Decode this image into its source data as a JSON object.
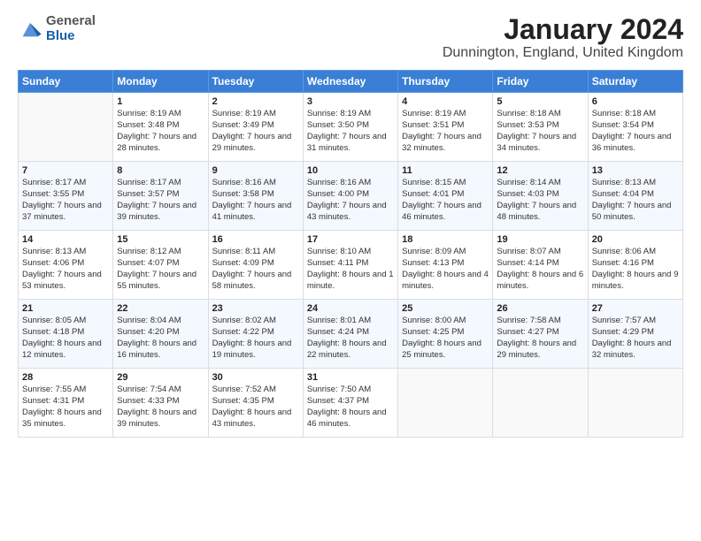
{
  "header": {
    "logo_general": "General",
    "logo_blue": "Blue",
    "title": "January 2024",
    "location": "Dunnington, England, United Kingdom"
  },
  "days_of_week": [
    "Sunday",
    "Monday",
    "Tuesday",
    "Wednesday",
    "Thursday",
    "Friday",
    "Saturday"
  ],
  "weeks": [
    [
      {
        "day": "",
        "empty": true
      },
      {
        "day": "1",
        "sunrise": "Sunrise: 8:19 AM",
        "sunset": "Sunset: 3:48 PM",
        "daylight": "Daylight: 7 hours and 28 minutes."
      },
      {
        "day": "2",
        "sunrise": "Sunrise: 8:19 AM",
        "sunset": "Sunset: 3:49 PM",
        "daylight": "Daylight: 7 hours and 29 minutes."
      },
      {
        "day": "3",
        "sunrise": "Sunrise: 8:19 AM",
        "sunset": "Sunset: 3:50 PM",
        "daylight": "Daylight: 7 hours and 31 minutes."
      },
      {
        "day": "4",
        "sunrise": "Sunrise: 8:19 AM",
        "sunset": "Sunset: 3:51 PM",
        "daylight": "Daylight: 7 hours and 32 minutes."
      },
      {
        "day": "5",
        "sunrise": "Sunrise: 8:18 AM",
        "sunset": "Sunset: 3:53 PM",
        "daylight": "Daylight: 7 hours and 34 minutes."
      },
      {
        "day": "6",
        "sunrise": "Sunrise: 8:18 AM",
        "sunset": "Sunset: 3:54 PM",
        "daylight": "Daylight: 7 hours and 36 minutes."
      }
    ],
    [
      {
        "day": "7",
        "sunrise": "Sunrise: 8:17 AM",
        "sunset": "Sunset: 3:55 PM",
        "daylight": "Daylight: 7 hours and 37 minutes."
      },
      {
        "day": "8",
        "sunrise": "Sunrise: 8:17 AM",
        "sunset": "Sunset: 3:57 PM",
        "daylight": "Daylight: 7 hours and 39 minutes."
      },
      {
        "day": "9",
        "sunrise": "Sunrise: 8:16 AM",
        "sunset": "Sunset: 3:58 PM",
        "daylight": "Daylight: 7 hours and 41 minutes."
      },
      {
        "day": "10",
        "sunrise": "Sunrise: 8:16 AM",
        "sunset": "Sunset: 4:00 PM",
        "daylight": "Daylight: 7 hours and 43 minutes."
      },
      {
        "day": "11",
        "sunrise": "Sunrise: 8:15 AM",
        "sunset": "Sunset: 4:01 PM",
        "daylight": "Daylight: 7 hours and 46 minutes."
      },
      {
        "day": "12",
        "sunrise": "Sunrise: 8:14 AM",
        "sunset": "Sunset: 4:03 PM",
        "daylight": "Daylight: 7 hours and 48 minutes."
      },
      {
        "day": "13",
        "sunrise": "Sunrise: 8:13 AM",
        "sunset": "Sunset: 4:04 PM",
        "daylight": "Daylight: 7 hours and 50 minutes."
      }
    ],
    [
      {
        "day": "14",
        "sunrise": "Sunrise: 8:13 AM",
        "sunset": "Sunset: 4:06 PM",
        "daylight": "Daylight: 7 hours and 53 minutes."
      },
      {
        "day": "15",
        "sunrise": "Sunrise: 8:12 AM",
        "sunset": "Sunset: 4:07 PM",
        "daylight": "Daylight: 7 hours and 55 minutes."
      },
      {
        "day": "16",
        "sunrise": "Sunrise: 8:11 AM",
        "sunset": "Sunset: 4:09 PM",
        "daylight": "Daylight: 7 hours and 58 minutes."
      },
      {
        "day": "17",
        "sunrise": "Sunrise: 8:10 AM",
        "sunset": "Sunset: 4:11 PM",
        "daylight": "Daylight: 8 hours and 1 minute."
      },
      {
        "day": "18",
        "sunrise": "Sunrise: 8:09 AM",
        "sunset": "Sunset: 4:13 PM",
        "daylight": "Daylight: 8 hours and 4 minutes."
      },
      {
        "day": "19",
        "sunrise": "Sunrise: 8:07 AM",
        "sunset": "Sunset: 4:14 PM",
        "daylight": "Daylight: 8 hours and 6 minutes."
      },
      {
        "day": "20",
        "sunrise": "Sunrise: 8:06 AM",
        "sunset": "Sunset: 4:16 PM",
        "daylight": "Daylight: 8 hours and 9 minutes."
      }
    ],
    [
      {
        "day": "21",
        "sunrise": "Sunrise: 8:05 AM",
        "sunset": "Sunset: 4:18 PM",
        "daylight": "Daylight: 8 hours and 12 minutes."
      },
      {
        "day": "22",
        "sunrise": "Sunrise: 8:04 AM",
        "sunset": "Sunset: 4:20 PM",
        "daylight": "Daylight: 8 hours and 16 minutes."
      },
      {
        "day": "23",
        "sunrise": "Sunrise: 8:02 AM",
        "sunset": "Sunset: 4:22 PM",
        "daylight": "Daylight: 8 hours and 19 minutes."
      },
      {
        "day": "24",
        "sunrise": "Sunrise: 8:01 AM",
        "sunset": "Sunset: 4:24 PM",
        "daylight": "Daylight: 8 hours and 22 minutes."
      },
      {
        "day": "25",
        "sunrise": "Sunrise: 8:00 AM",
        "sunset": "Sunset: 4:25 PM",
        "daylight": "Daylight: 8 hours and 25 minutes."
      },
      {
        "day": "26",
        "sunrise": "Sunrise: 7:58 AM",
        "sunset": "Sunset: 4:27 PM",
        "daylight": "Daylight: 8 hours and 29 minutes."
      },
      {
        "day": "27",
        "sunrise": "Sunrise: 7:57 AM",
        "sunset": "Sunset: 4:29 PM",
        "daylight": "Daylight: 8 hours and 32 minutes."
      }
    ],
    [
      {
        "day": "28",
        "sunrise": "Sunrise: 7:55 AM",
        "sunset": "Sunset: 4:31 PM",
        "daylight": "Daylight: 8 hours and 35 minutes."
      },
      {
        "day": "29",
        "sunrise": "Sunrise: 7:54 AM",
        "sunset": "Sunset: 4:33 PM",
        "daylight": "Daylight: 8 hours and 39 minutes."
      },
      {
        "day": "30",
        "sunrise": "Sunrise: 7:52 AM",
        "sunset": "Sunset: 4:35 PM",
        "daylight": "Daylight: 8 hours and 43 minutes."
      },
      {
        "day": "31",
        "sunrise": "Sunrise: 7:50 AM",
        "sunset": "Sunset: 4:37 PM",
        "daylight": "Daylight: 8 hours and 46 minutes."
      },
      {
        "day": "",
        "empty": true
      },
      {
        "day": "",
        "empty": true
      },
      {
        "day": "",
        "empty": true
      }
    ]
  ]
}
